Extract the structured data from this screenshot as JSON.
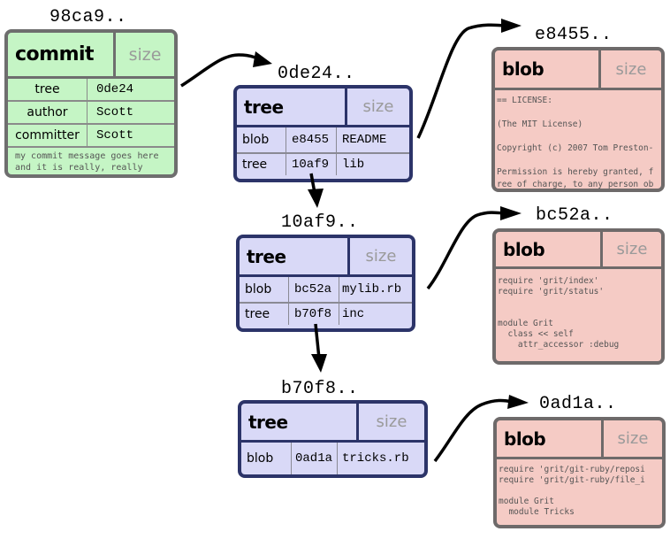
{
  "commit": {
    "hash": "98ca9..",
    "type": "commit",
    "size_label": "size",
    "fields": [
      {
        "label": "tree",
        "value": "0de24"
      },
      {
        "label": "author",
        "value": "Scott"
      },
      {
        "label": "committer",
        "value": "Scott"
      }
    ],
    "message_lines": [
      "my commit message goes here",
      "and it is really, really cool"
    ]
  },
  "trees": [
    {
      "hash": "0de24..",
      "type": "tree",
      "size_label": "size",
      "entries": [
        {
          "kind": "blob",
          "sha": "e8455",
          "name": "README"
        },
        {
          "kind": "tree",
          "sha": "10af9",
          "name": "lib"
        }
      ]
    },
    {
      "hash": "10af9..",
      "type": "tree",
      "size_label": "size",
      "entries": [
        {
          "kind": "blob",
          "sha": "bc52a",
          "name": "mylib.rb"
        },
        {
          "kind": "tree",
          "sha": "b70f8",
          "name": "inc"
        }
      ]
    },
    {
      "hash": "b70f8..",
      "type": "tree",
      "size_label": "size",
      "entries": [
        {
          "kind": "blob",
          "sha": "0ad1a",
          "name": "tricks.rb"
        }
      ]
    }
  ],
  "blobs": [
    {
      "hash": "e8455..",
      "type": "blob",
      "size_label": "size",
      "content": "== LICENSE:\n\n(The MIT License)\n\nCopyright (c) 2007 Tom Preston-\n\nPermission is hereby granted, f\nree of charge, to any person ob"
    },
    {
      "hash": "bc52a..",
      "type": "blob",
      "size_label": "size",
      "content": "require 'grit/index'\nrequire 'grit/status'\n\n\nmodule Grit\n  class << self\n    attr_accessor :debug"
    },
    {
      "hash": "0ad1a..",
      "type": "blob",
      "size_label": "size",
      "content": "require 'grit/git-ruby/reposi\nrequire 'grit/git-ruby/file_i\n\nmodule Grit\n  module Tricks"
    }
  ],
  "colors": {
    "commit_fill": "#c5f5c5",
    "tree_fill": "#d9d9f7",
    "tree_border": "#2c3469",
    "blob_fill": "#f5cbc5",
    "border_gray": "#6e6e6e"
  }
}
